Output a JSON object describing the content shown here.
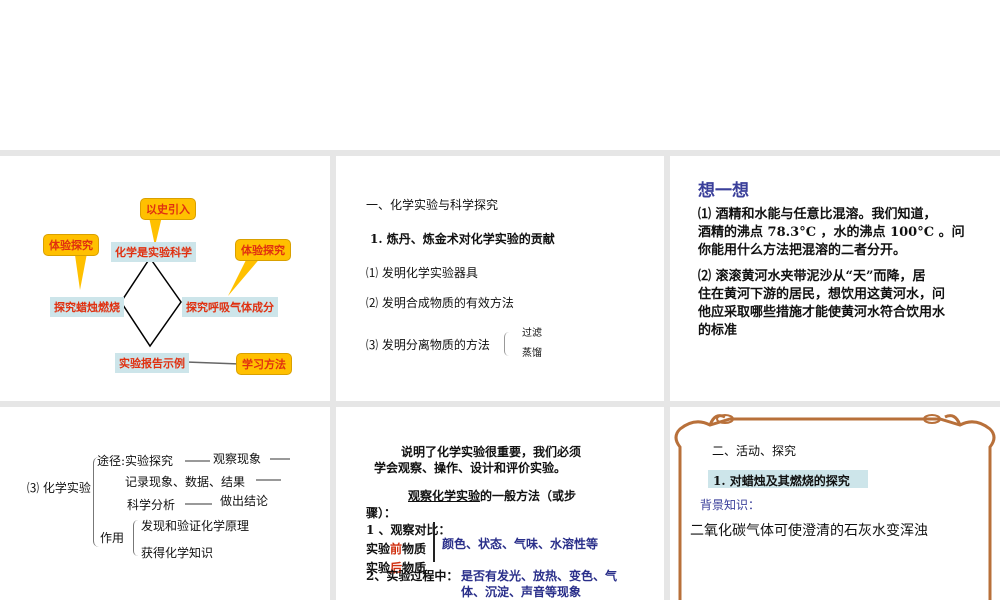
{
  "slide1": {
    "center": "化学是实验科学",
    "left": "探究蜡烛燃烧",
    "right": "探究呼吸气体成分",
    "bottom": "实验报告示例",
    "callout_top": "以史引入",
    "callout_left": "体验探究",
    "callout_right": "体验探究",
    "callout_bottom": "学习方法",
    "colors": {
      "box": "#cde5ea",
      "callout": "#ffc000",
      "text": "#e03010"
    }
  },
  "slide2": {
    "heading": "一、化学实验与科学探究",
    "sub": "1. 炼丹、炼金术对化学实验的贡献",
    "items": [
      "⑴ 发明化学实验器具",
      "⑵ 发明合成物质的有效方法",
      "⑶ 发明分离物质的方法"
    ],
    "methods": [
      "过滤",
      "蒸馏"
    ]
  },
  "slide3": {
    "title": "想一想",
    "p1": [
      "⑴ 酒精和水能与任意比混溶。我们知道，",
      "酒精的沸点 78.3°C ，水的沸点 100°C 。问",
      "你能用什么方法把混溶的二者分开。"
    ],
    "p2": [
      " ⑵ 滚滚黄河水夹带泥沙从“天”而降，居",
      "住在黄河下游的居民，想饮用这黄河水，问",
      "他应采取哪些措施才能使黄河水符合饮用水",
      "的标准"
    ]
  },
  "slide4": {
    "root": "⑶ 化学实验",
    "path_label": "途径:",
    "path": [
      "实验探究",
      "观察现象",
      "记录现象、数据、结果",
      "科学分析",
      "做出结论"
    ],
    "role_label": "作用",
    "roles": [
      "发现和验证化学原理",
      "获得化学知识"
    ]
  },
  "slide5": {
    "intro": [
      "说明了化学实验很重要，我们必须",
      "学会观察、操作、设计和评价实验。"
    ],
    "method_u": "观察化学实验",
    "method_rest": "的一般方法（或步",
    "method_rest2": "骤）：",
    "step1": "1 、观察对比：",
    "before_a": "实验",
    "before_b": "前",
    "before_c": "物质",
    "after_a": "实验",
    "after_b": "后",
    "after_c": "物质",
    "compare": "颜色、状态、气味、水溶性等",
    "step2": "2、实验过程中：",
    "process": [
      "是否有发光、放热、变色、气",
      "体、沉淀、声音等现象"
    ]
  },
  "slide6": {
    "heading": "二、活动、探究",
    "sub": "1. 对蜡烛及其燃烧的探究",
    "bg_label": "背景知识：",
    "fact": "二氧化碳气体可使澄清的石灰水变浑浊"
  }
}
